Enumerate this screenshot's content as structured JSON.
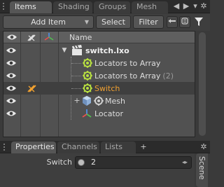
{
  "top_tabs": [
    {
      "label": "Items",
      "active": true
    },
    {
      "label": "Shading",
      "active": false
    },
    {
      "label": "Groups",
      "active": false
    },
    {
      "label": "Mesh",
      "active": false
    }
  ],
  "toolbar": {
    "add_item_label": "Add Item",
    "select_label": "Select",
    "filter_label": "Filter"
  },
  "list": {
    "column_name_header": "Name",
    "rows": [
      {
        "label": "switch.lxo",
        "suffix": "",
        "icon": "clapper-icon",
        "visible": true,
        "locked": false,
        "selected": false
      },
      {
        "label": "Locators to Array",
        "suffix": "",
        "icon": "replicator-gear-icon",
        "visible": true,
        "locked": false,
        "selected": false
      },
      {
        "label": "Locators to Array",
        "suffix": "(2)",
        "icon": "replicator-gear-icon",
        "visible": true,
        "locked": false,
        "selected": false
      },
      {
        "label": "Switch",
        "suffix": "",
        "icon": "replicator-gear-icon",
        "visible": true,
        "locked": true,
        "selected": true
      },
      {
        "label": "Mesh",
        "suffix": "",
        "icon": "cube-icon",
        "visible": true,
        "locked": false,
        "selected": false
      },
      {
        "label": "Locator",
        "suffix": "",
        "icon": "locator-axes-icon",
        "visible": true,
        "locked": false,
        "selected": false
      }
    ]
  },
  "bottom_tabs": [
    {
      "label": "Properties",
      "active": true
    },
    {
      "label": "Channels",
      "active": false
    },
    {
      "label": "Lists",
      "active": false
    },
    {
      "label": "+",
      "active": false
    }
  ],
  "properties": {
    "switch_label": "Switch",
    "switch_value": "2"
  },
  "side_tab": {
    "label": "Scene"
  },
  "colors": {
    "selected_text": "#f0a030",
    "selected_row": "#3f3f3f",
    "panel_bg": "#515151",
    "active_tab": "#565656"
  }
}
